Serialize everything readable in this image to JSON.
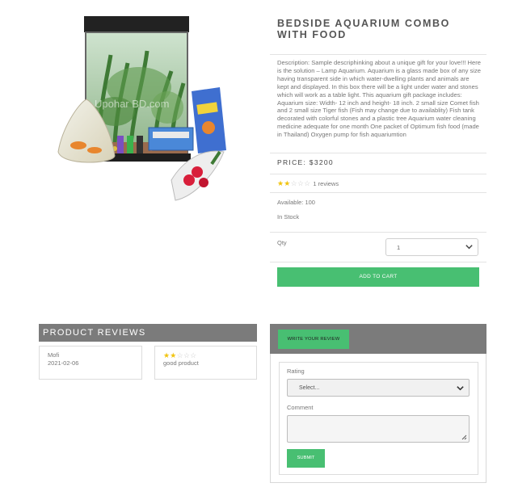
{
  "product": {
    "title": "BEDSIDE AQUARIUM COMBO WITH FOOD",
    "description": "Description: Sample descriphinking about a unique gift for your love!!! Here is the solution – Lamp Aquarium. Aquarium is a glass made box of any size having transparent side in which water-dwelling plants and animals are kept and displayed. In this box there will be a light under water and stones which will work as a table light. This aquarium gift package includes: Aquarium size: Width- 12 inch and height- 18 inch. 2 small size Comet fish and 2 small size Tiger fish (Fish may change due to availablity) Fish tank decorated with colorful stones and a plastic tree Aquarium water cleaning medicine adequate for one month One packet of Optimum fish food (made in Thailand) Oxygen pump for fish aquariumtion",
    "price": "PRICE: $3200",
    "rating_stars": 2,
    "reviews_count": "1 reviews",
    "available": "Available: 100",
    "stock_status": "In Stock",
    "qty_label": "Qty",
    "qty_value": "1",
    "add_to_cart": "ADD TO CART",
    "image_watermark": "Upohar BD.com"
  },
  "reviews": {
    "header": "PRODUCT REVIEWS",
    "items": [
      {
        "reviewer": "Mofi",
        "date": "2021-02-06",
        "stars": 2,
        "text": "good product"
      }
    ]
  },
  "review_form": {
    "write_button": "WRITE YOUR REVIEW",
    "rating_label": "Rating",
    "rating_placeholder": "Select...",
    "comment_label": "Comment",
    "submit_button": "SUBMIT"
  },
  "colors": {
    "accent_green": "#48bf72",
    "header_gray": "#7b7b7b",
    "star_yellow": "#f1c40f"
  }
}
